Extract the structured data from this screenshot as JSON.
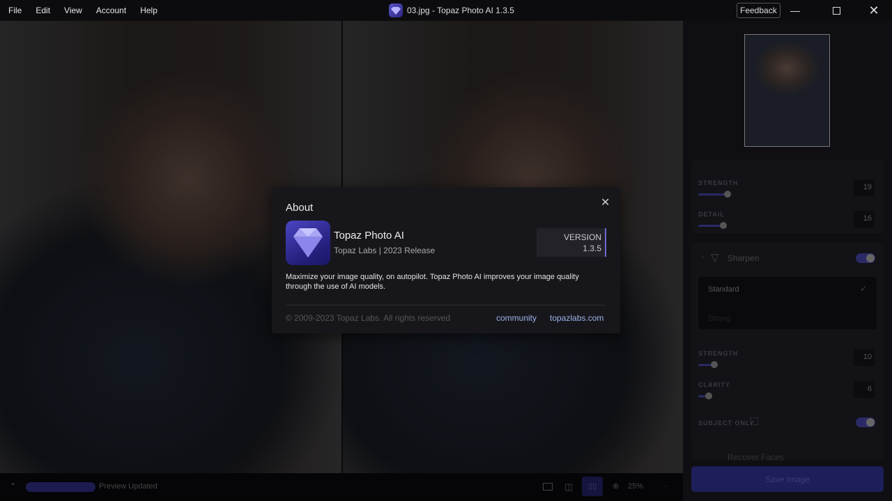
{
  "menu": [
    "File",
    "Edit",
    "View",
    "Account",
    "Help"
  ],
  "window_title": "03.jpg - Topaz Photo AI 1.3.5",
  "feedback": "Feedback",
  "side": {
    "denoise": {
      "strength_label": "STRENGTH",
      "strength": "19",
      "detail_label": "DETAIL",
      "detail": "16",
      "strength_frac": 0.42,
      "detail_frac": 0.36
    },
    "sharpen": {
      "title": "Sharpen",
      "options": [
        "Standard",
        "Strong"
      ],
      "selected": "Standard",
      "strength_label": "STRENGTH",
      "strength": "10",
      "clarity_label": "CLARITY",
      "clarity": "6",
      "subject_only_label": "SUBJECT ONLY",
      "strength_frac": 0.22,
      "clarity_frac": 0.14
    },
    "recover_faces": "Recover Faces",
    "save": "Save Image"
  },
  "bottom": {
    "status": "Preview Updated",
    "zoom": "25%"
  },
  "about": {
    "title": "About",
    "app_name": "Topaz Photo AI",
    "app_sub": "Topaz Labs | 2023 Release",
    "version_label": "VERSION",
    "version": "1.3.5",
    "description": "Maximize your image quality, on autopilot. Topaz Photo AI improves your image quality through the use of AI models.",
    "copyright": "© 2009-2023 Topaz Labs. All rights reserved",
    "links": [
      "community",
      "topazlabs.com"
    ]
  },
  "colors": {
    "accent": "#6a6ad8",
    "link": "#9db1e8"
  }
}
